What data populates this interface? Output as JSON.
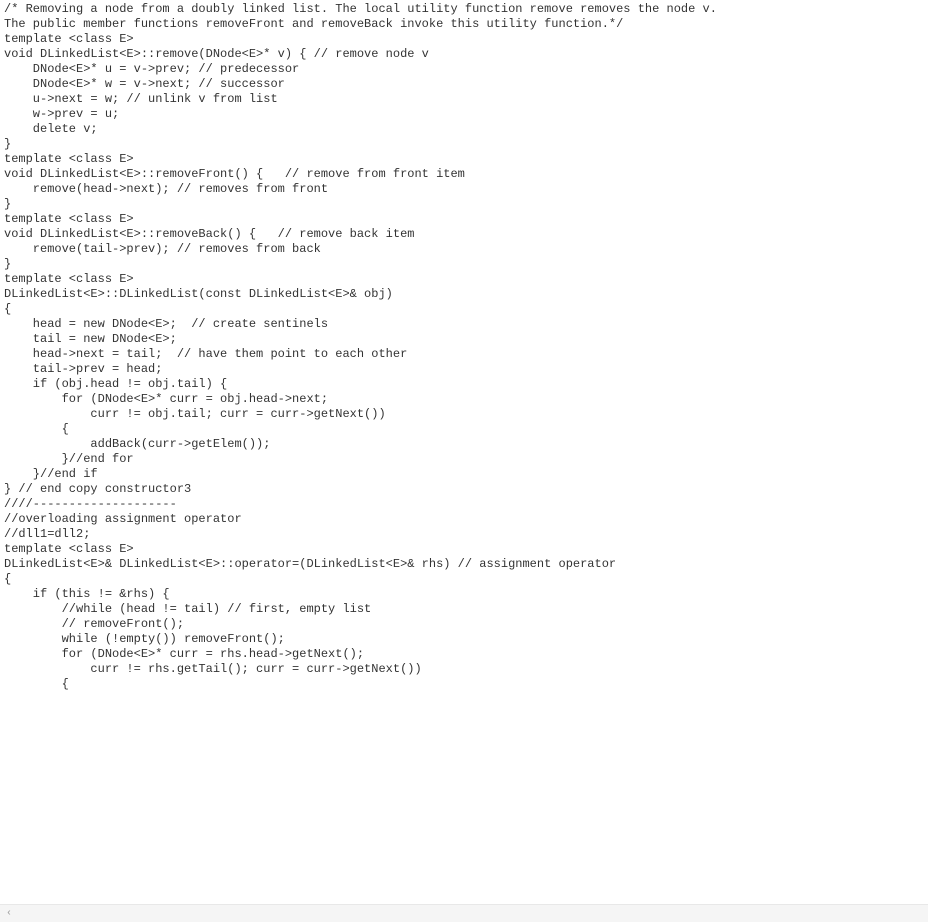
{
  "code_lines": [
    "/* Removing a node from a doubly linked list. The local utility function remove removes the node v.",
    "The public member functions removeFront and removeBack invoke this utility function.*/",
    "template <class E>",
    "void DLinkedList<E>::remove(DNode<E>* v) { // remove node v",
    "    DNode<E>* u = v->prev; // predecessor",
    "    DNode<E>* w = v->next; // successor",
    "    u->next = w; // unlink v from list",
    "    w->prev = u;",
    "    delete v;",
    "}",
    "",
    "",
    "",
    "template <class E>",
    "void DLinkedList<E>::removeFront() {   // remove from front item",
    "    remove(head->next); // removes from front",
    "}",
    "",
    "template <class E>",
    "void DLinkedList<E>::removeBack() {   // remove back item",
    "    remove(tail->prev); // removes from back",
    "}",
    "",
    "template <class E>",
    "DLinkedList<E>::DLinkedList(const DLinkedList<E>& obj)",
    "",
    "{",
    "    head = new DNode<E>;  // create sentinels",
    "    tail = new DNode<E>;",
    "    head->next = tail;  // have them point to each other",
    "    tail->prev = head;",
    "",
    "    if (obj.head != obj.tail) {",
    "",
    "        for (DNode<E>* curr = obj.head->next;",
    "            curr != obj.tail; curr = curr->getNext())",
    "        {",
    "            addBack(curr->getElem());",
    "",
    "        }//end for",
    "    }//end if",
    "} // end copy constructor3",
    "",
    "",
    "",
    "////--------------------",
    "//overloading assignment operator",
    "",
    "//dll1=dll2;",
    "template <class E>",
    "DLinkedList<E>& DLinkedList<E>::operator=(DLinkedList<E>& rhs) // assignment operator",
    "{",
    "    if (this != &rhs) {",
    "        //while (head != tail) // first, empty list",
    "        // removeFront();",
    "        while (!empty()) removeFront();",
    "        for (DNode<E>* curr = rhs.head->getNext();",
    "            curr != rhs.getTail(); curr = curr->getNext())",
    "        {"
  ],
  "scroll_left_glyph": "‹"
}
